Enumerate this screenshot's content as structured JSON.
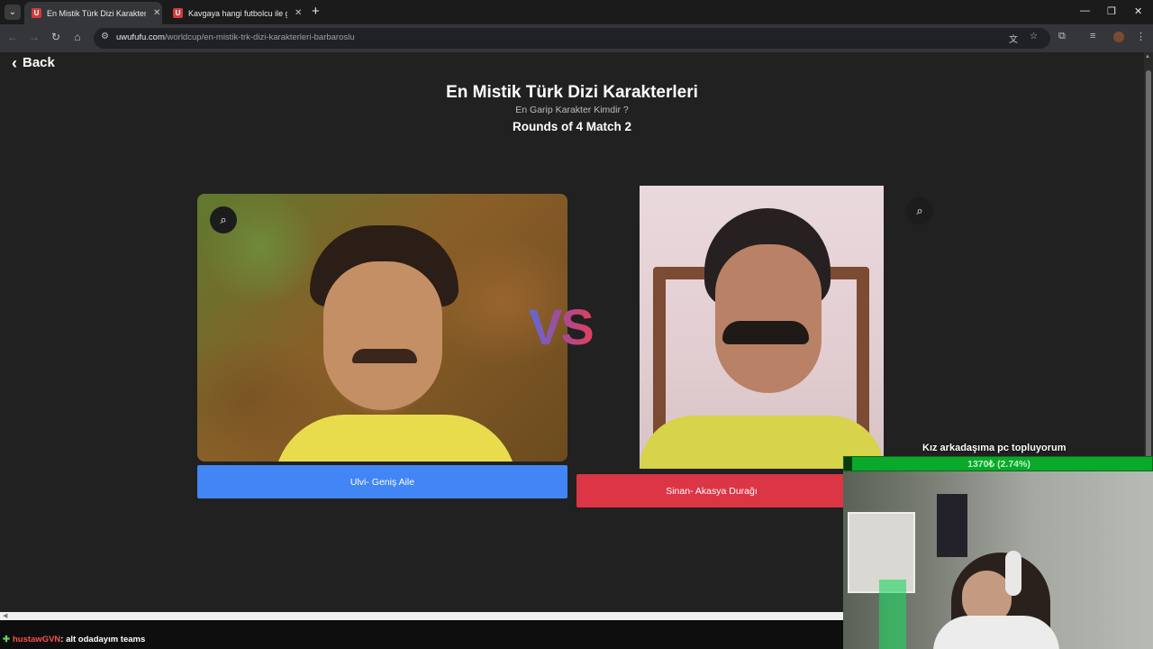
{
  "browser": {
    "tabs": [
      {
        "title": "En Mistik Türk Dizi Karakterleri",
        "favicon": "U",
        "active": true
      },
      {
        "title": "Kavgaya hangi futbolcu ile gide",
        "favicon": "U",
        "active": false
      }
    ],
    "new_tab_label": "+",
    "url_host": "uwufufu.com",
    "url_path": "/worldcup/en-mistik-trk-dizi-karakterleri-barbaroslu"
  },
  "page": {
    "back_label": "Back",
    "title": "En Mistik Türk Dizi Karakterleri",
    "subtitle": "En Garip Karakter Kimdir ?",
    "round_label": "Rounds of 4 Match 2",
    "vs_label": "VS",
    "left_choice": {
      "label": "Ulvi- Geniş Aile",
      "color": "#4285f4"
    },
    "right_choice": {
      "label": "Sinan- Akasya Durağı",
      "color": "#dc3545"
    }
  },
  "stream_overlay": {
    "goal_text": "Kız arkadaşıma pc topluyorum",
    "goal_progress_text": "1370₺ (2.74%)",
    "goal_progress_fraction": 0.0274,
    "chat": {
      "badge": "✚",
      "user": "hustawGVN",
      "message": ": alt odadayım teams"
    }
  },
  "icons": {
    "back": "chevron-left-icon",
    "zoom": "zoom-in-icon"
  }
}
